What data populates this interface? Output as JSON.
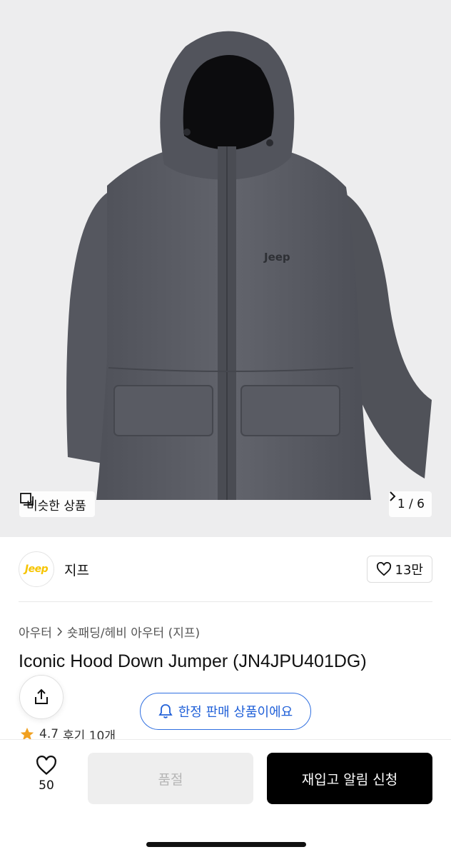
{
  "gallery": {
    "similar_label": "비슷한 상품",
    "pager": "1 / 6",
    "print_text": "Jeep"
  },
  "brand": {
    "logo_text": "Jeep",
    "name": "지프",
    "like_count": "13만",
    "logo_color": "#f6c400"
  },
  "product": {
    "breadcrumb": [
      "아우터",
      "숏패딩/헤비 아우터 (지프)"
    ],
    "title": "Iconic Hood Down Jumper (JN4JPU401DG)",
    "limited_notice": "한정 판매 상품이에요",
    "rating": "4.7",
    "reviews": "후기 10개"
  },
  "bottom_bar": {
    "wish_count": "50",
    "soldout_label": "품절",
    "restock_label": "재입고 알림 신청"
  },
  "colors": {
    "accent_blue": "#2f6fe0",
    "star": "#f0a020",
    "jacket": "#5c5e66"
  },
  "icons": [
    "similar-items-icon",
    "chevron-right-icon",
    "heart-icon",
    "share-icon",
    "bell-icon",
    "star-icon"
  ]
}
